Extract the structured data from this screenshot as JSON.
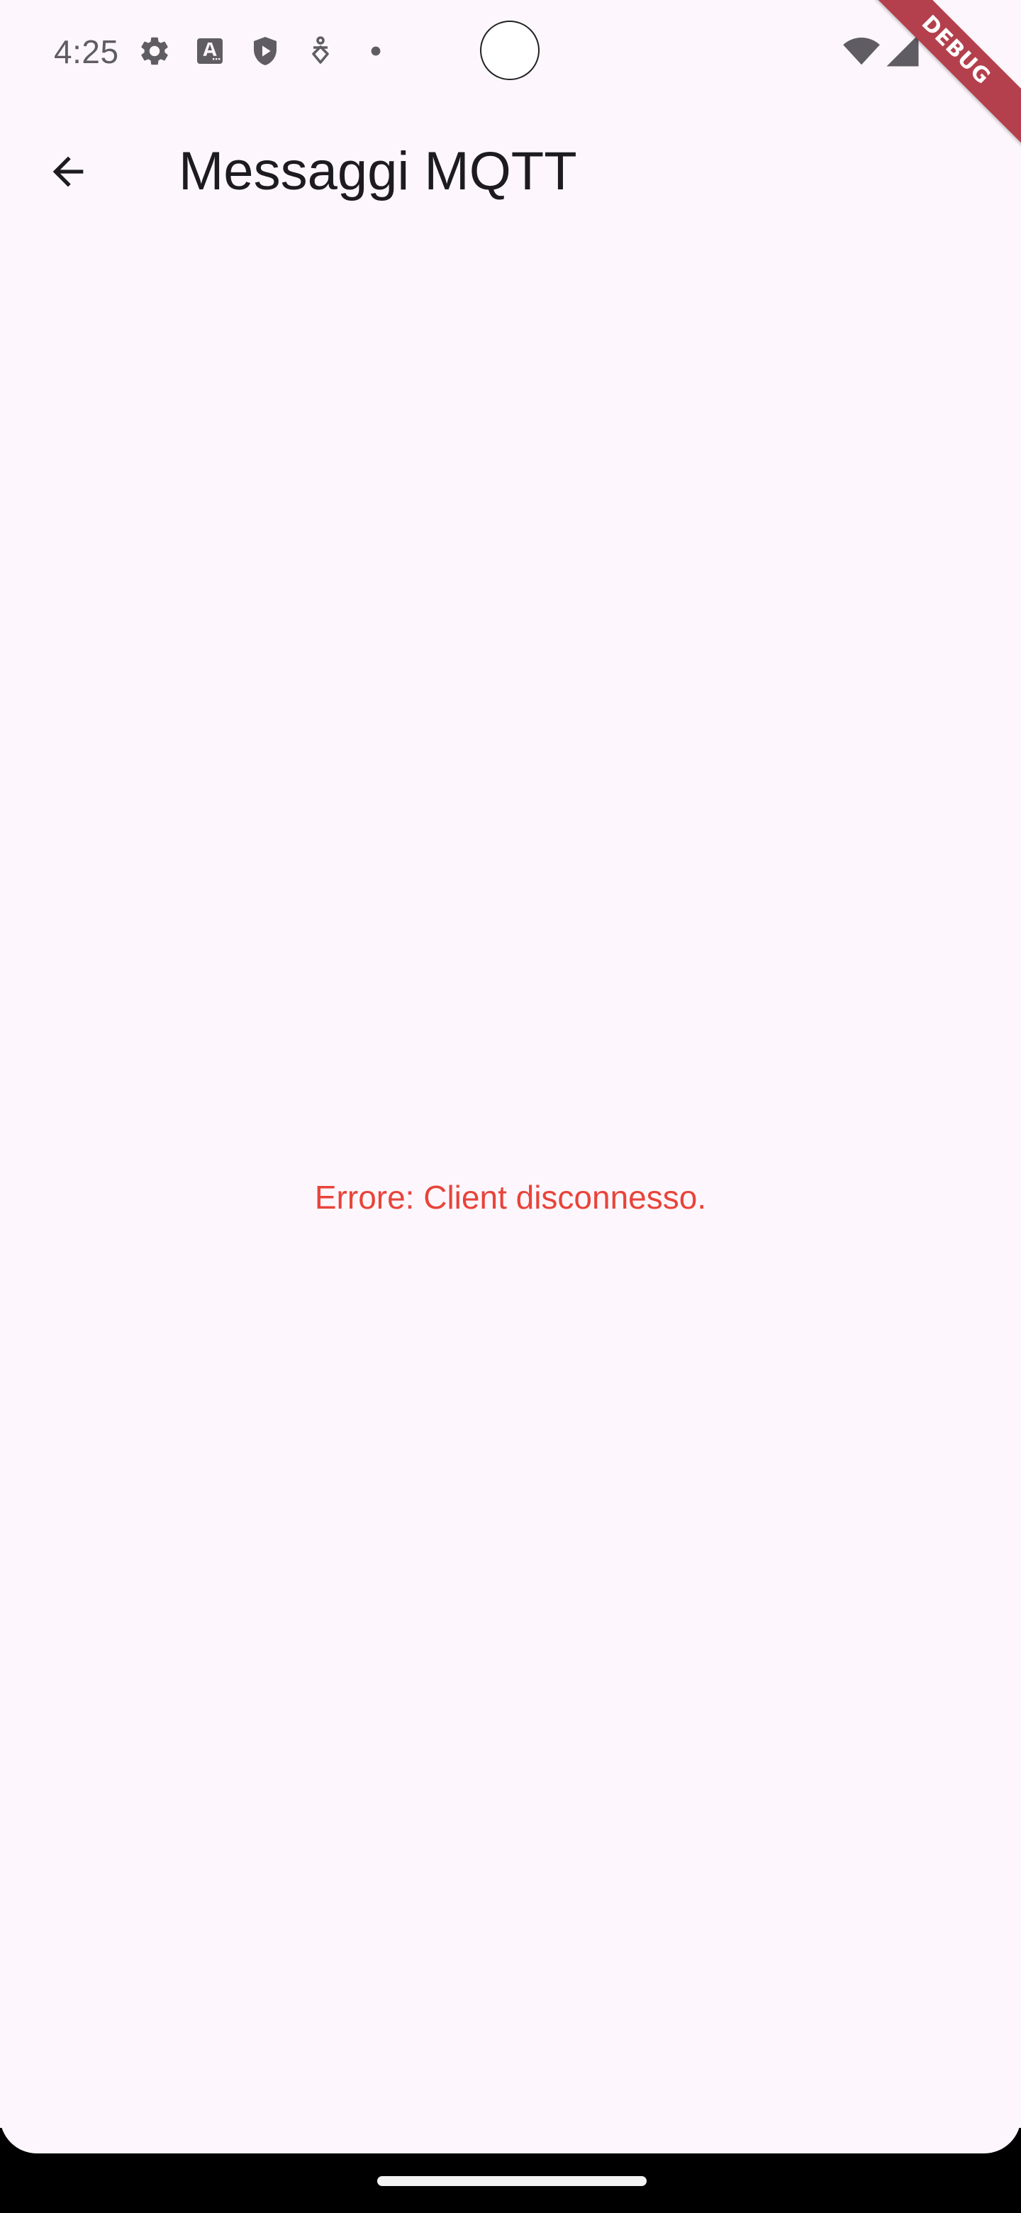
{
  "status_bar": {
    "time": "4:25",
    "left_icons": [
      "settings-icon",
      "font-icon",
      "shield-play-icon",
      "accessibility-icon",
      "dot-icon"
    ],
    "right_icons": [
      "wifi-icon",
      "cellular-signal-icon"
    ]
  },
  "app_bar": {
    "back_icon": "arrow-back-icon",
    "title": "Messaggi MQTT"
  },
  "body": {
    "error_message": "Errore: Client disconnesso.",
    "error_color": "#e8443a"
  },
  "debug_banner": {
    "label": "DEBUG",
    "color": "#b3404c"
  },
  "colors": {
    "background": "#fdf7fd",
    "title_text": "#1d1b20",
    "status_icons": "#5f5d63"
  }
}
